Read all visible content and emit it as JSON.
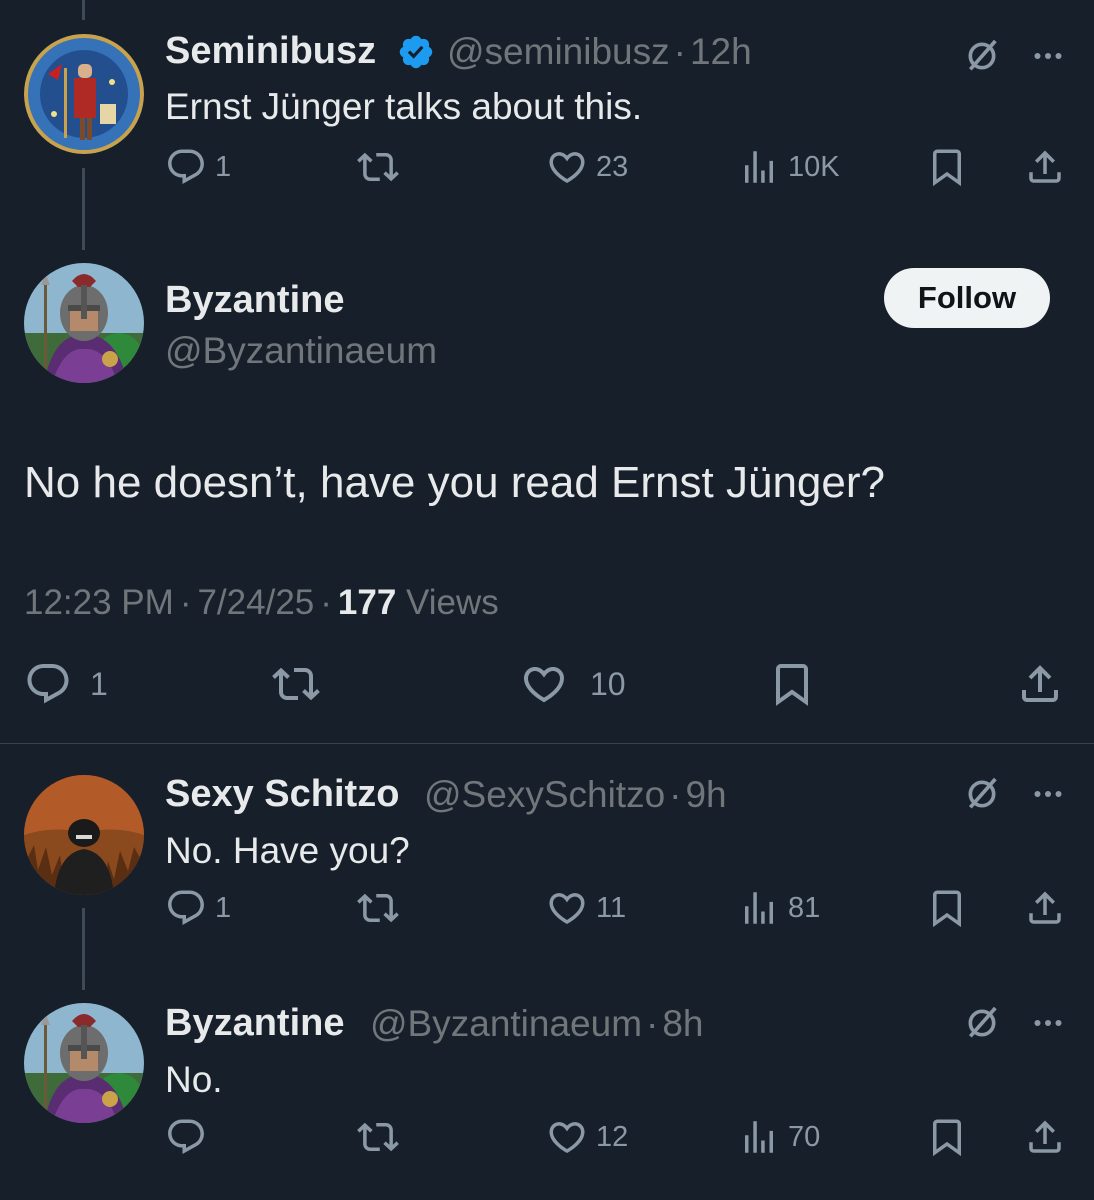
{
  "colors": {
    "background": "#17202a",
    "text": "#e7e9ea",
    "muted": "#71767b",
    "icon": "#8b98a5",
    "verified": "#1d9bf0",
    "divider": "#38444d"
  },
  "tweet1": {
    "name": "Seminibusz",
    "handle": "@seminibusz",
    "sep": "·",
    "time": "12h",
    "text": "Ernst Jünger talks about this.",
    "reply_count": "1",
    "like_count": "23",
    "view_count": "10K",
    "verified_icon": "verified-badge-icon"
  },
  "main": {
    "name": "Byzantine",
    "handle": "@Byzantinaeum",
    "follow_label": "Follow",
    "text": "No he doesn’t, have you read Ernst Jünger?",
    "time": "12:23 PM",
    "sep1": "·",
    "date": "7/24/25",
    "sep2": "·",
    "views_count": "177",
    "views_label": "Views",
    "reply_count": "1",
    "like_count": "10"
  },
  "reply1": {
    "name": "Sexy Schitzo",
    "handle": "@SexySchitzo",
    "sep": "·",
    "time": "9h",
    "text": "No. Have you?",
    "reply_count": "1",
    "like_count": "11",
    "view_count": "81"
  },
  "reply2": {
    "name": "Byzantine",
    "handle": "@Byzantinaeum",
    "sep": "·",
    "time": "8h",
    "text": "No.",
    "like_count": "12",
    "view_count": "70"
  }
}
